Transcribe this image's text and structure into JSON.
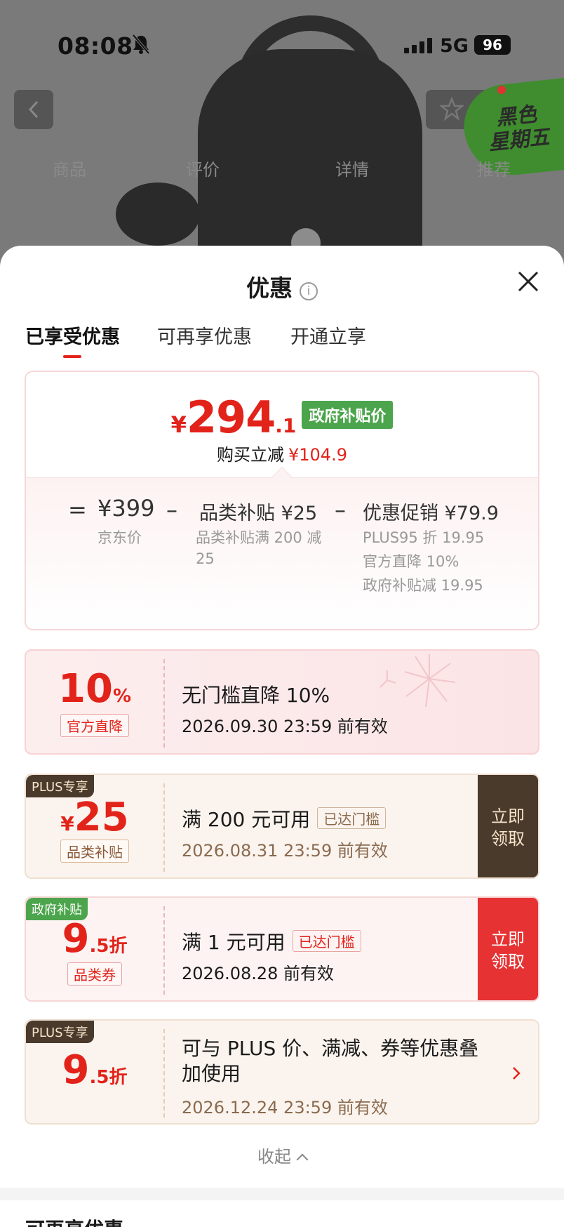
{
  "status_bar": {
    "time": "08:08",
    "network": "5G",
    "battery": "96"
  },
  "background_page": {
    "promo_badge_line1": "黑色",
    "promo_badge_line2": "星期五",
    "tabs": [
      "商品",
      "评价",
      "详情",
      "推荐"
    ]
  },
  "sheet": {
    "title": "优惠",
    "info_icon": "i",
    "tabs": [
      {
        "label": "已享受优惠",
        "active": true
      },
      {
        "label": "可再享优惠",
        "active": false
      },
      {
        "label": "开通立享",
        "active": false
      }
    ],
    "summary": {
      "currency": "¥",
      "price_int": "294",
      "price_dec": ".1",
      "tag": "政府补贴价",
      "reduce_label": "购买立减",
      "reduce_amount": "¥104.9",
      "equals": "=",
      "minus": "–",
      "jd_price": "¥399",
      "jd_price_label": "京东价",
      "category_subsidy_title": "品类补贴 ¥25",
      "category_subsidy_line1": "品类补贴满 200 减",
      "category_subsidy_line2": "25",
      "promo_title": "优惠促销 ¥79.9",
      "promo_details": [
        "PLUS95 折 19.95",
        "官方直降 10%",
        "政府补贴减 19.95"
      ]
    },
    "coupons": [
      {
        "value": "10",
        "unit": "%",
        "tag": "官方直降",
        "description": "无门槛直降 10%",
        "validity": "2026.09.30 23:59 前有效"
      },
      {
        "corner": "PLUS专享",
        "currency": "¥",
        "value": "25",
        "tag": "品类补贴",
        "description": "满 200 元可用",
        "reached": "已达门槛",
        "validity": "2026.08.31 23:59 前有效",
        "button": "立即领取"
      },
      {
        "corner": "政府补贴",
        "value": "9",
        "unit": ".5折",
        "tag": "品类券",
        "description": "满 1 元可用",
        "reached": "已达门槛",
        "validity": "2026.08.28 前有效",
        "button": "立即领取"
      },
      {
        "corner": "PLUS专享",
        "value": "9",
        "unit": ".5折",
        "description_line1": "可与 PLUS 价、满减、券等优惠叠",
        "description_line2": "加使用",
        "validity": "2026.12.24 23:59 前有效"
      }
    ],
    "collapse": "收起",
    "next_section": "可再享优惠"
  },
  "colors": {
    "accent": "#e2231a",
    "gov_green": "#4ca54c",
    "plus_brown": "#4a3a2c"
  }
}
